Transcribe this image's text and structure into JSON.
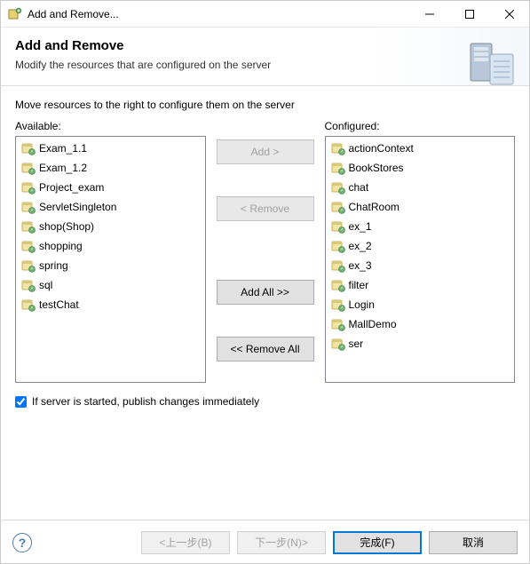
{
  "window": {
    "title": "Add and Remove..."
  },
  "header": {
    "title": "Add and Remove",
    "subtitle": "Modify the resources that are configured on the server"
  },
  "content": {
    "instruction": "Move resources to the right to configure them on the server",
    "available_label": "Available:",
    "configured_label": "Configured:",
    "available": [
      "Exam_1.1",
      "Exam_1.2",
      "Project_exam",
      "ServletSingleton",
      "shop(Shop)",
      "shopping",
      "spring",
      "sql",
      "testChat"
    ],
    "configured": [
      "actionContext",
      "BookStores",
      "chat",
      "ChatRoom",
      "ex_1",
      "ex_2",
      "ex_3",
      "filter",
      "Login",
      "MallDemo",
      "ser"
    ],
    "buttons": {
      "add": "Add >",
      "remove": "< Remove",
      "add_all": "Add All >>",
      "remove_all": "<< Remove All"
    },
    "checkbox_label": "If server is started, publish changes immediately",
    "checkbox_checked": true
  },
  "footer": {
    "back": "<上一步(B)",
    "next": "下一步(N)>",
    "finish": "完成(F)",
    "cancel": "取消"
  }
}
